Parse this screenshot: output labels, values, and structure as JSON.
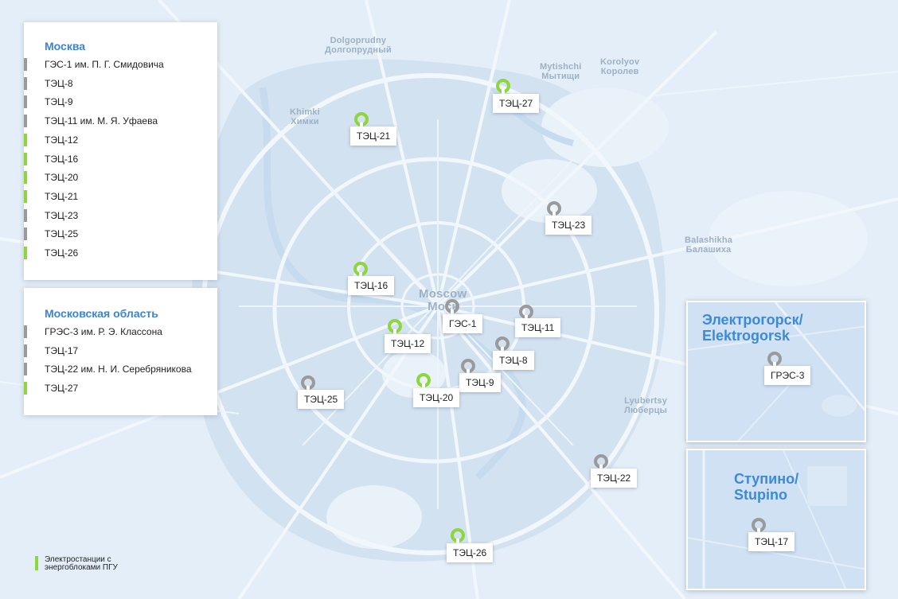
{
  "colors": {
    "ccgt": "#8fd63c",
    "other": "#9a9a9a",
    "accent": "#3c83d2"
  },
  "city_labels": {
    "moscow": [
      "Moscow",
      "Моск"
    ],
    "khimki": [
      "Khimki",
      "Химки"
    ],
    "mytishchi": [
      "Mytishchi",
      "Мытищи"
    ],
    "korolyov": [
      "Korolyov",
      "Королев"
    ],
    "balashikha": [
      "Balashikha",
      "Балашиха"
    ],
    "lyubertsy": [
      "Lyubertsy",
      "Люберцы"
    ],
    "dolgoprudny": [
      "Dolgoprudny",
      "Долгопрудный"
    ]
  },
  "panel_moscow": {
    "title": "Москва",
    "items": [
      {
        "label": "ГЭС-1 им. П. Г. Смидовича",
        "ccgt": false
      },
      {
        "label": "ТЭЦ-8",
        "ccgt": false
      },
      {
        "label": "ТЭЦ-9",
        "ccgt": false
      },
      {
        "label": "ТЭЦ-11 им. М. Я. Уфаева",
        "ccgt": false
      },
      {
        "label": "ТЭЦ-12",
        "ccgt": true
      },
      {
        "label": "ТЭЦ-16",
        "ccgt": true
      },
      {
        "label": "ТЭЦ-20",
        "ccgt": true
      },
      {
        "label": "ТЭЦ-21",
        "ccgt": true
      },
      {
        "label": "ТЭЦ-23",
        "ccgt": false
      },
      {
        "label": "ТЭЦ-25",
        "ccgt": false
      },
      {
        "label": "ТЭЦ-26",
        "ccgt": true
      }
    ]
  },
  "panel_region": {
    "title": "Московская область",
    "items": [
      {
        "label": "ГРЭС-3 им. Р. Э. Классона",
        "ccgt": false
      },
      {
        "label": "ТЭЦ-17",
        "ccgt": false
      },
      {
        "label": "ТЭЦ-22 им. Н. И. Серебряникова",
        "ccgt": false
      },
      {
        "label": "ТЭЦ-27",
        "ccgt": true
      }
    ]
  },
  "stations": [
    {
      "id": "tec-27",
      "label": "ТЭЦ-27",
      "ccgt": true
    },
    {
      "id": "tec-21",
      "label": "ТЭЦ-21",
      "ccgt": true
    },
    {
      "id": "tec-23",
      "label": "ТЭЦ-23",
      "ccgt": false
    },
    {
      "id": "tec-16",
      "label": "ТЭЦ-16",
      "ccgt": true
    },
    {
      "id": "ges-1",
      "label": "ГЭС-1",
      "ccgt": false
    },
    {
      "id": "tec-11",
      "label": "ТЭЦ-11",
      "ccgt": false
    },
    {
      "id": "tec-12",
      "label": "ТЭЦ-12",
      "ccgt": true
    },
    {
      "id": "tec-8",
      "label": "ТЭЦ-8",
      "ccgt": false
    },
    {
      "id": "tec-9",
      "label": "ТЭЦ-9",
      "ccgt": false
    },
    {
      "id": "tec-20",
      "label": "ТЭЦ-20",
      "ccgt": true
    },
    {
      "id": "tec-25",
      "label": "ТЭЦ-25",
      "ccgt": false
    },
    {
      "id": "tec-22",
      "label": "ТЭЦ-22",
      "ccgt": false
    },
    {
      "id": "tec-26",
      "label": "ТЭЦ-26",
      "ccgt": true
    }
  ],
  "insets": {
    "elektrogorsk": {
      "title": [
        "Электрогорск/",
        "Elektrogorsk"
      ],
      "station": {
        "label": "ГРЭС-3",
        "ccgt": false
      }
    },
    "stupino": {
      "title": [
        "Ступино/",
        "Stupino"
      ],
      "station": {
        "label": "ТЭЦ-17",
        "ccgt": false
      }
    }
  },
  "legend": {
    "text": "Электростанции с энергоблоками ПГУ"
  }
}
